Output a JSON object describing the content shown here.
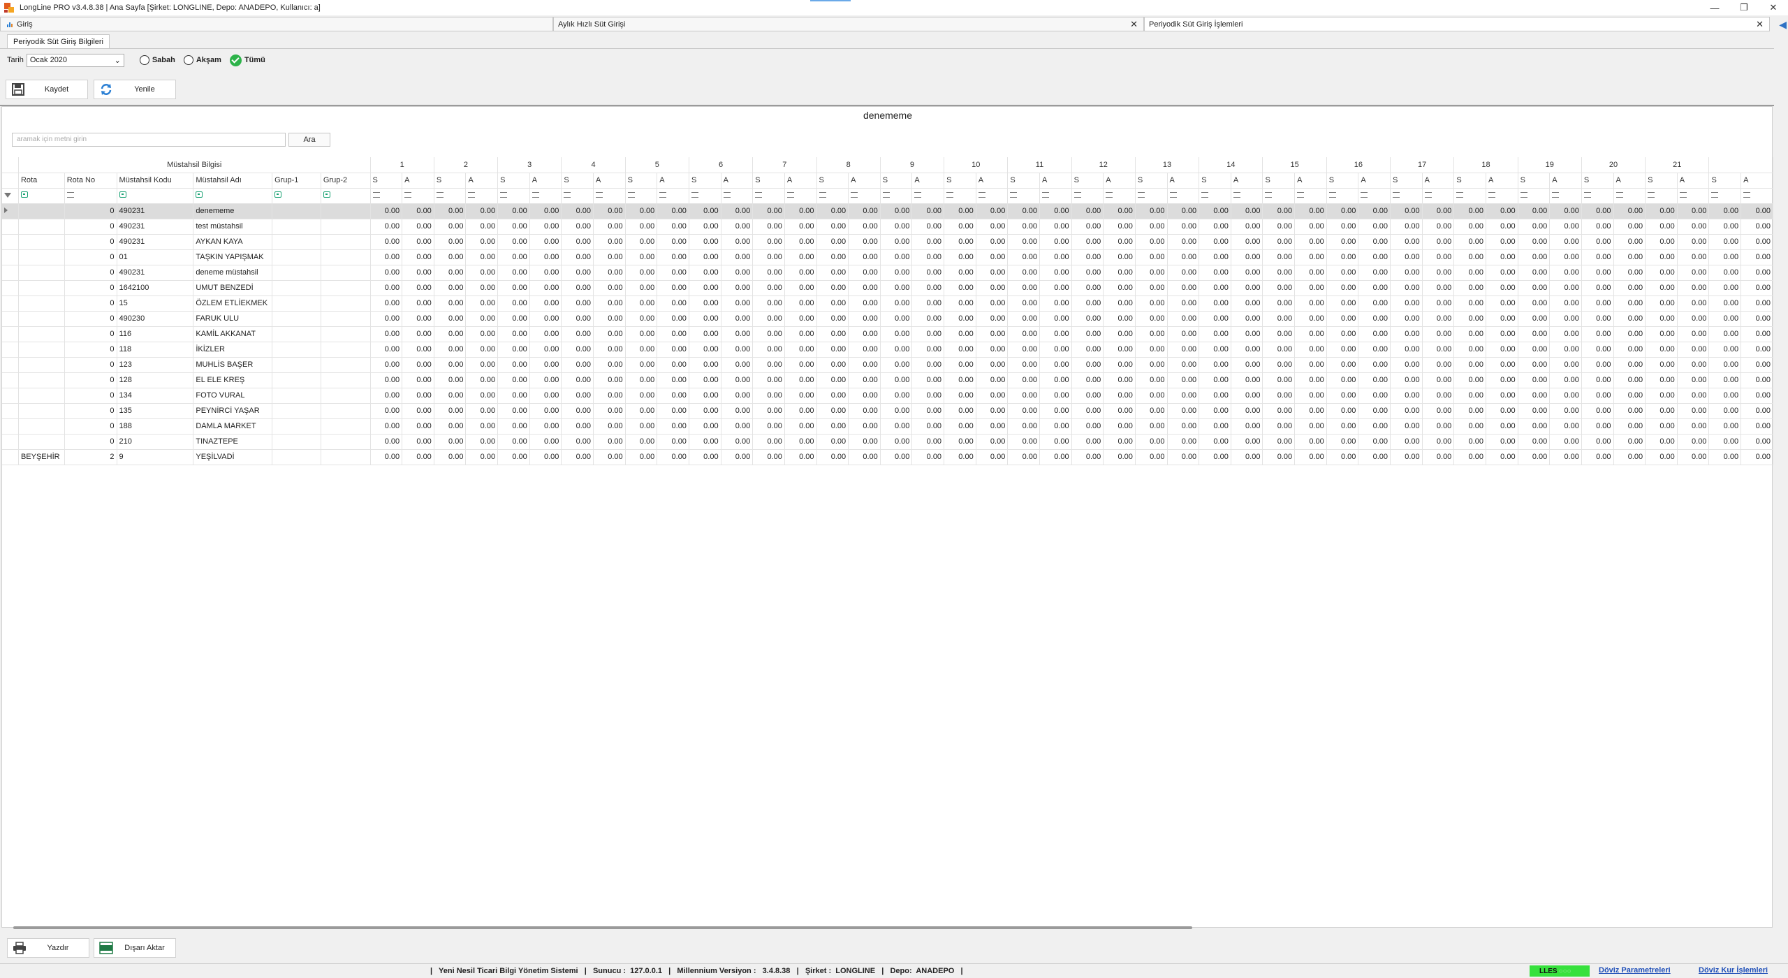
{
  "window": {
    "title": "LongLine PRO v3.4.8.38 | Ana Sayfa [Şirket: LONGLINE, Depo: ANADEPO, Kullanıcı: a]",
    "minimize": "—",
    "restore": "❐",
    "close": "✕"
  },
  "doc_tabs": [
    {
      "label": "Giriş"
    },
    {
      "label": "Aylık Hızlı Süt Girişi",
      "close": "✕"
    },
    {
      "label": "Periyodik Süt Giriş İşlemleri",
      "close": "✕"
    }
  ],
  "side_arrow": "◀",
  "sub_tab": "Periyodik Süt Giriş Bilgileri",
  "filters": {
    "date_label": "Tarih",
    "date_value": "Ocak 2020",
    "date_chevron": "⌄",
    "radio_morning": "Sabah",
    "radio_evening": "Akşam",
    "radio_all": "Tümü",
    "selected": "Tümü"
  },
  "toolbar": {
    "save": "Kaydet",
    "refresh": "Yenile"
  },
  "grid": {
    "title": "denememe",
    "search_placeholder": "aramak için metni girin",
    "search_button": "Ara",
    "band_header": "Müstahsil Bilgisi",
    "columns": [
      "Rota",
      "Rota No",
      "Müstahsil Kodu",
      "Müstahsil Adı",
      "Grup-1",
      "Grup-2"
    ],
    "days": [
      "1",
      "2",
      "3",
      "4",
      "5",
      "6",
      "7",
      "8",
      "9",
      "10",
      "11",
      "12",
      "13",
      "14",
      "15",
      "16",
      "17",
      "18",
      "19",
      "20",
      "21",
      ""
    ],
    "sub_morning": "S",
    "sub_evening": "A",
    "cell_value": "0.00",
    "rows": [
      {
        "rota": "",
        "rota_no": "0",
        "kod": "490231",
        "ad": "denememe"
      },
      {
        "rota": "",
        "rota_no": "0",
        "kod": "490231",
        "ad": "test müstahsil"
      },
      {
        "rota": "",
        "rota_no": "0",
        "kod": "490231",
        "ad": "AYKAN KAYA"
      },
      {
        "rota": "",
        "rota_no": "0",
        "kod": "01",
        "ad": "TAŞKIN YAPIŞMAK"
      },
      {
        "rota": "",
        "rota_no": "0",
        "kod": "490231",
        "ad": "deneme müstahsil"
      },
      {
        "rota": "",
        "rota_no": "0",
        "kod": "1642100",
        "ad": "UMUT BENZEDİ"
      },
      {
        "rota": "",
        "rota_no": "0",
        "kod": "15",
        "ad": "ÖZLEM ETLİEKMEK"
      },
      {
        "rota": "",
        "rota_no": "0",
        "kod": "490230",
        "ad": "FARUK ULU"
      },
      {
        "rota": "",
        "rota_no": "0",
        "kod": "116",
        "ad": "KAMİL AKKANAT"
      },
      {
        "rota": "",
        "rota_no": "0",
        "kod": "118",
        "ad": "İKİZLER"
      },
      {
        "rota": "",
        "rota_no": "0",
        "kod": "123",
        "ad": "MUHLİS BAŞER"
      },
      {
        "rota": "",
        "rota_no": "0",
        "kod": "128",
        "ad": "EL ELE KREŞ"
      },
      {
        "rota": "",
        "rota_no": "0",
        "kod": "134",
        "ad": "FOTO VURAL"
      },
      {
        "rota": "",
        "rota_no": "0",
        "kod": "135",
        "ad": "PEYNİRCİ YAŞAR"
      },
      {
        "rota": "",
        "rota_no": "0",
        "kod": "188",
        "ad": "DAMLA MARKET"
      },
      {
        "rota": "",
        "rota_no": "0",
        "kod": "210",
        "ad": "TINAZTEPE"
      },
      {
        "rota": "BEYŞEHİR",
        "rota_no": "2",
        "kod": "9",
        "ad": "YEŞİLVADİ"
      }
    ]
  },
  "bottom_toolbar": {
    "print": "Yazdır",
    "export": "Dışarı Aktar"
  },
  "status": {
    "text": "|   Yeni Nesil Ticari Bilgi Yönetim Sistemi   |   Sunucu :  127.0.0.1   |   Millennium Versiyon :   3.4.8.38   |   Şirket :  LONGLINE   |   Depo:  ANADEPO   |",
    "badge": "LLES",
    "badge_dots": "○○○",
    "link1": "Döviz Parametreleri",
    "link2": "Döviz Kur İşlemleri"
  },
  "colors": {
    "accent_green": "#2db34a",
    "status_green": "#37e13d",
    "link_blue": "#1f4fb8"
  }
}
